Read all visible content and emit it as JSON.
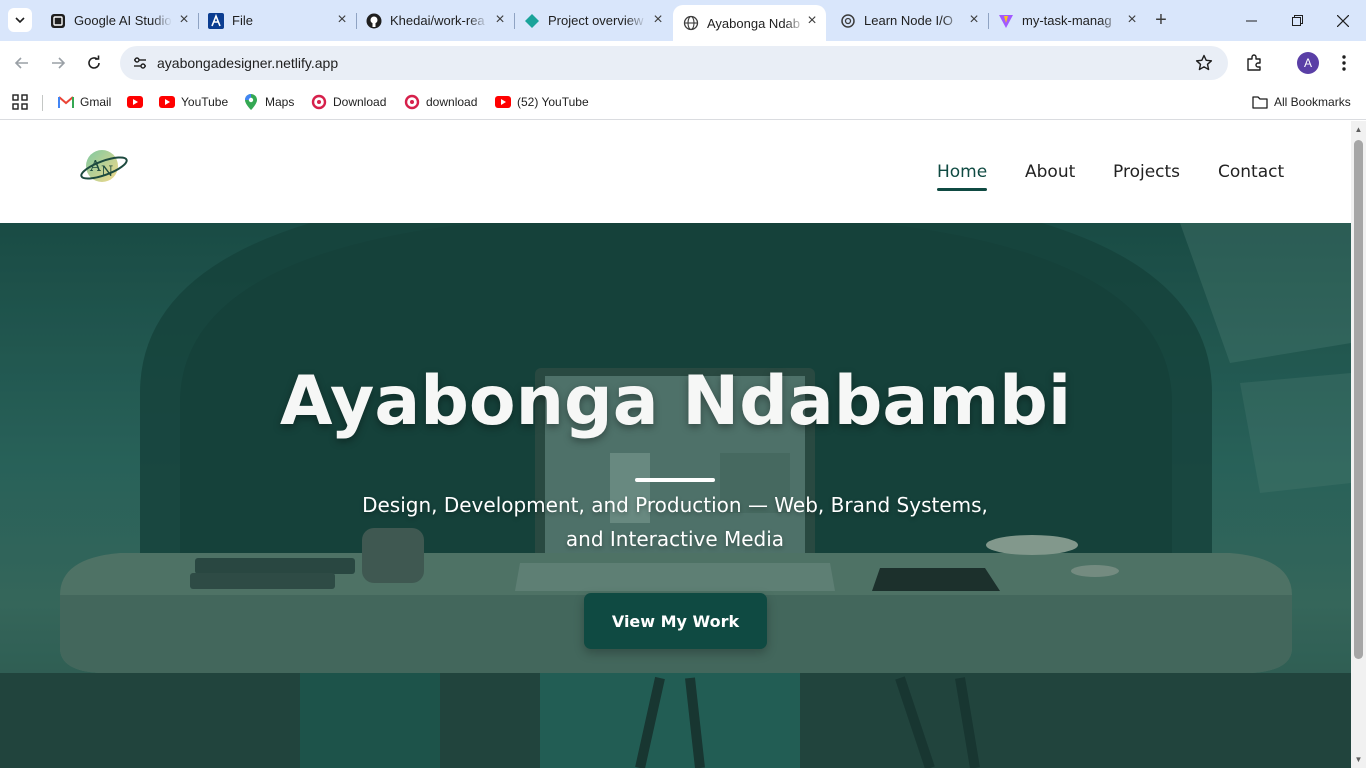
{
  "browser": {
    "tabs": [
      {
        "title": "Google AI Studio",
        "icon": "google-ai-studio-icon",
        "active": false
      },
      {
        "title": "File",
        "icon": "file-app-icon",
        "active": false
      },
      {
        "title": "Khedai/work-rea",
        "icon": "github-icon",
        "active": false
      },
      {
        "title": "Project overview",
        "icon": "project-diamond-icon",
        "active": false
      },
      {
        "title": "Ayabonga Ndab",
        "icon": "globe-icon",
        "active": true
      },
      {
        "title": "Learn Node I/O",
        "icon": "openai-icon",
        "active": false
      },
      {
        "title": "my-task-manag",
        "icon": "vite-icon",
        "active": false
      }
    ],
    "url": "ayabongadesigner.netlify.app",
    "profile_initial": "A",
    "bookmarks": [
      {
        "label": "Gmail",
        "icon": "gmail-icon"
      },
      {
        "label": "",
        "icon": "youtube-icon"
      },
      {
        "label": "YouTube",
        "icon": "youtube-icon"
      },
      {
        "label": "Maps",
        "icon": "maps-icon"
      },
      {
        "label": "Download",
        "icon": "download-site-icon"
      },
      {
        "label": "download",
        "icon": "download-site-icon"
      },
      {
        "label": "(52) YouTube",
        "icon": "youtube-icon"
      }
    ],
    "all_bookmarks_label": "All Bookmarks"
  },
  "site": {
    "logo_text": "AN",
    "nav": [
      {
        "label": "Home",
        "active": true
      },
      {
        "label": "About",
        "active": false
      },
      {
        "label": "Projects",
        "active": false
      },
      {
        "label": "Contact",
        "active": false
      }
    ],
    "hero": {
      "title": "Ayabonga Ndabambi",
      "subtitle_line1": "Design, Development, and Production — Web, Brand Systems,",
      "subtitle_line2": "and Interactive Media",
      "cta_label": "View My Work"
    }
  },
  "colors": {
    "brand_green": "#0f4a42",
    "tabstrip_bg": "#d9e6fb",
    "hero_overlay": "#1c4f48"
  }
}
